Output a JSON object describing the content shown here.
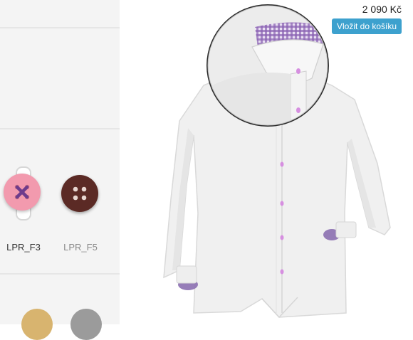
{
  "product": {
    "price": "2 090 Kč"
  },
  "actions": {
    "add_to_cart_label": "Vložit do košíku"
  },
  "button_options": [
    {
      "label": "LPR_F3",
      "color": "#f29aae",
      "thread_color": "#6e3c8c",
      "selected": true
    },
    {
      "label": "LPR_F5",
      "color": "#5b2a25",
      "selected": false
    }
  ],
  "color_swatches": [
    "#d8b46f",
    "#9b9b9b"
  ],
  "colors": {
    "accent": "#3da1ce",
    "shirt": "#f0f0f0",
    "cuff_lining": "#8b6fb0",
    "stitch": "#d68fe0"
  }
}
